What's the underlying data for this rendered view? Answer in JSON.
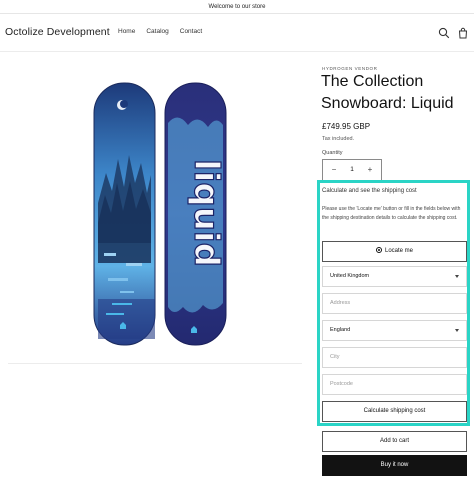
{
  "announcement": "Welcome to our store",
  "header": {
    "brand": "Octolize Development",
    "nav": [
      "Home",
      "Catalog",
      "Contact"
    ]
  },
  "product": {
    "vendor": "HYDROGEN VENDOR",
    "title": "The Collection Snowboard: Liquid",
    "price": "£749.95 GBP",
    "tax_note": "Tax included.",
    "quantity_label": "Quantity",
    "quantity_value": "1",
    "add_to_cart": "Add to cart",
    "buy_now": "Buy it now",
    "board_graphic_text": "liquid"
  },
  "shipping": {
    "title": "Calculate and see the shipping cost",
    "description": "Please use the 'Locate me' button or fill in the fields below with the shipping destination details to calculate the shipping cost.",
    "locate_label": "Locate me",
    "country": "United Kingdom",
    "address_placeholder": "Address",
    "region": "England",
    "city_placeholder": "City",
    "postcode_placeholder": "Postcode",
    "calculate_label": "Calculate shipping cost"
  },
  "colors": {
    "highlight": "#2ad4c6",
    "primary_button": "#121212"
  },
  "icons": {
    "search": "search-icon",
    "cart": "cart-icon",
    "locate": "crosshair-icon"
  }
}
